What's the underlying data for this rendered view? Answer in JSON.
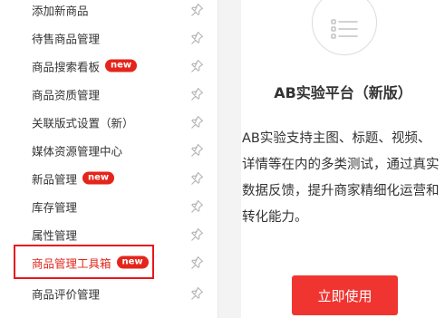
{
  "sidebar": {
    "items": [
      {
        "label": "添加新商品",
        "badge": ""
      },
      {
        "label": "待售商品管理",
        "badge": ""
      },
      {
        "label": "商品搜索看板",
        "badge": "new"
      },
      {
        "label": "商品资质管理",
        "badge": ""
      },
      {
        "label": "关联版式设置（新）",
        "badge": ""
      },
      {
        "label": "媒体资源管理中心",
        "badge": ""
      },
      {
        "label": "新品管理",
        "badge": "new"
      },
      {
        "label": "库存管理",
        "badge": ""
      },
      {
        "label": "属性管理",
        "badge": ""
      },
      {
        "label": "商品管理工具箱",
        "badge": "new",
        "highlighted": true
      },
      {
        "label": "商品评价管理",
        "badge": ""
      }
    ],
    "pin_icon": "pin-icon"
  },
  "card": {
    "icon": "list-icon",
    "title": "AB实验平台（新版）",
    "description": "AB实验支持主图、标题、视频、详情等在内的多类测试，通过真实数据反馈，提升商家精细化运营和转化能力。",
    "button_label": "立即使用"
  },
  "colors": {
    "accent_red": "#f03531",
    "badge_red": "#e4251b",
    "highlight_border": "#e8181d",
    "text": "#333333"
  }
}
